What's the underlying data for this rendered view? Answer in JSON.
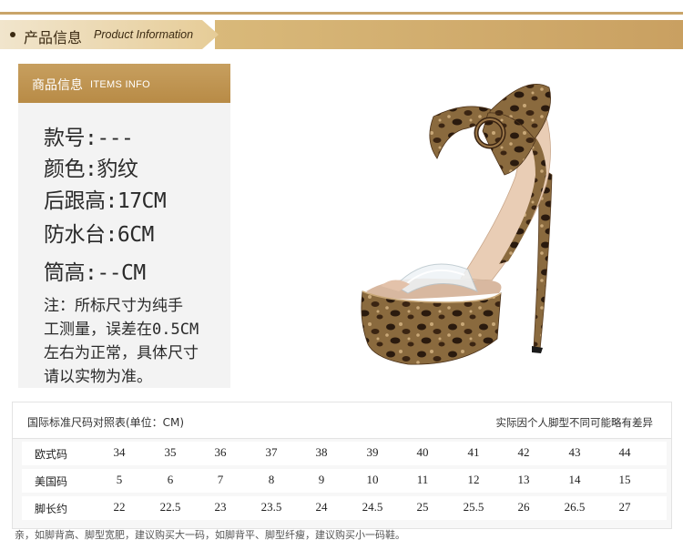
{
  "header": {
    "title_cn": "产品信息",
    "title_en": "Product Information"
  },
  "info": {
    "title_cn": "商品信息",
    "title_en": "ITEMS INFO",
    "specs": [
      "款号:---",
      "颜色:豹纹",
      "后跟高:17CM",
      "防水台:6CM",
      "筒高:--CM"
    ],
    "note_lines": [
      "注：所标尺寸为纯手",
      "工测量，误差在0.5CM",
      "左右为正常，具体尺寸",
      "请以实物为准。"
    ]
  },
  "product_image": {
    "icon": "leopard-platform-sandal-image",
    "colors": {
      "base": "#8a6a3e",
      "spot": "#2a1a0e",
      "sole": "#a8805a"
    }
  },
  "size_table": {
    "title": "国际标准尺码对照表(单位：CM)",
    "hint": "实际因个人脚型不同可能略有差异",
    "rows": [
      {
        "label": "欧式码",
        "values": [
          "34",
          "35",
          "36",
          "37",
          "38",
          "39",
          "40",
          "41",
          "42",
          "43",
          "44"
        ]
      },
      {
        "label": "美国码",
        "values": [
          "5",
          "6",
          "7",
          "8",
          "9",
          "10",
          "11",
          "12",
          "13",
          "14",
          "15"
        ]
      },
      {
        "label": "脚长约",
        "values": [
          "22",
          "22.5",
          "23",
          "23.5",
          "24",
          "24.5",
          "25",
          "25.5",
          "26",
          "26.5",
          "27"
        ]
      }
    ]
  },
  "footer_note": "亲，如脚背高、脚型宽肥，建议购买大一码，如脚背平、脚型纤瘦，建议购买小一码鞋。"
}
